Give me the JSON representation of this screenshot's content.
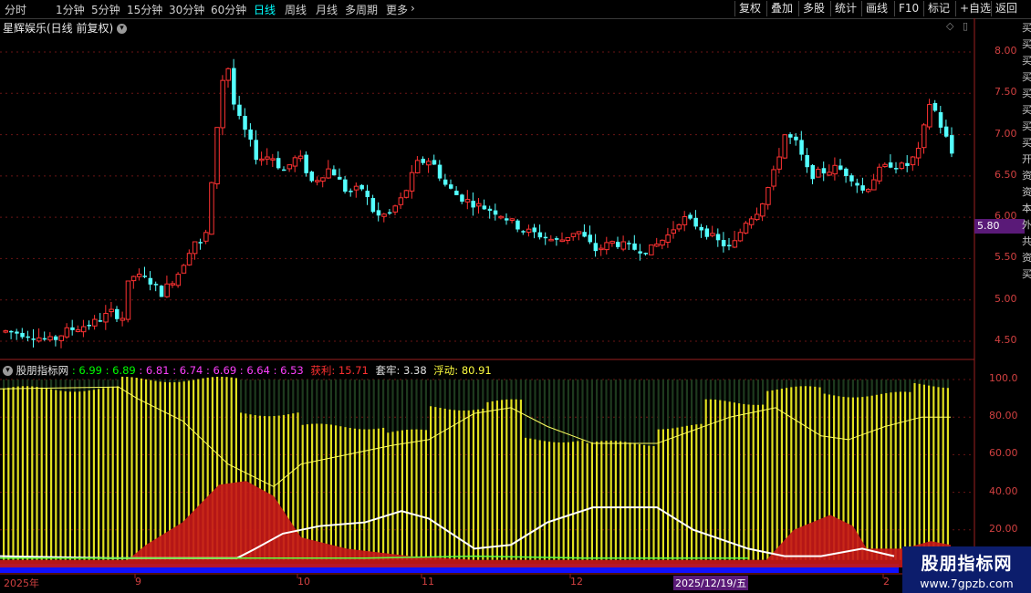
{
  "toolbar": {
    "tabs": [
      "分时",
      "1分钟",
      "5分钟",
      "15分钟",
      "30分钟",
      "60分钟",
      "日线",
      "周线",
      "月线",
      "多周期",
      "更多"
    ],
    "active_tab": "日线",
    "buttons": [
      "复权",
      "叠加",
      "多股",
      "统计",
      "画线",
      "F10",
      "标记",
      "+自选",
      "返回"
    ]
  },
  "main_chart": {
    "title": "星辉娱乐(日线 前复权)",
    "y_ticks": [
      "8.00",
      "7.50",
      "7.00",
      "6.50",
      "6.00",
      "5.50",
      "5.00",
      "4.50"
    ],
    "price_marker": "5.80"
  },
  "indicator": {
    "name": "股朋指标网",
    "values": [
      {
        "text": "6.99",
        "color": "#00ff00"
      },
      {
        "text": "6.89",
        "color": "#00ff00"
      },
      {
        "text": "6.81",
        "color": "#ff40ff"
      },
      {
        "text": "6.74",
        "color": "#ff40ff"
      },
      {
        "text": "6.69",
        "color": "#ff40ff"
      },
      {
        "text": "6.64",
        "color": "#ff40ff"
      },
      {
        "text": "6.53",
        "color": "#ff40ff"
      }
    ],
    "profit_label": "获利: 15.71",
    "trapped_label": "套牢: 3.38",
    "floating_label": "浮动: 80.91",
    "y_ticks": [
      "100.0",
      "80.00",
      "60.00",
      "40.00",
      "20.00"
    ]
  },
  "x_axis": {
    "labels": [
      "2025年",
      "9",
      "10",
      "11",
      "12",
      "2025/12/19/五",
      "2"
    ]
  },
  "watermark": {
    "line1": "股朋指标网",
    "line2": "www.7gpzb.com"
  },
  "side_chars": "买买买买买买买买开资资本外共资买"
}
